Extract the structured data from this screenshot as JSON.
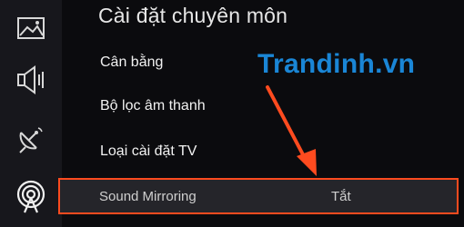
{
  "header": {
    "title": "Cài đặt chuyên môn"
  },
  "sidebar": {
    "icons": [
      {
        "name": "picture-icon",
        "active": false
      },
      {
        "name": "speaker-icon",
        "active": false
      },
      {
        "name": "satellite-dish-icon",
        "active": false
      },
      {
        "name": "broadcast-antenna-icon",
        "active": true
      }
    ]
  },
  "menu": {
    "items": [
      {
        "label": "Cân bằng"
      },
      {
        "label": "Bộ lọc âm thanh"
      },
      {
        "label": "Loại cài đặt TV"
      }
    ],
    "selected": {
      "label": "Sound Mirroring",
      "value": "Tắt"
    }
  },
  "overlay": {
    "watermark": "Trandinh.vn"
  },
  "colors": {
    "highlight_border": "#ff4b1f",
    "arrow": "#ff4b1f",
    "watermark": "#1a86d6",
    "background": "#0b0b0e",
    "rail": "#17171c"
  }
}
